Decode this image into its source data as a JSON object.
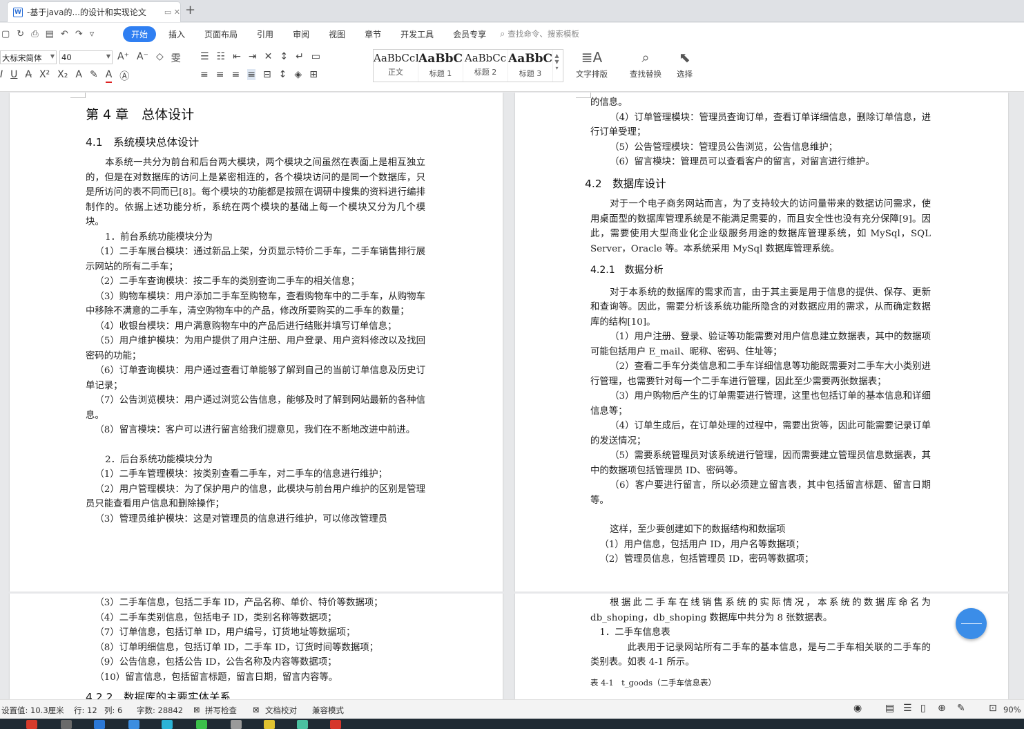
{
  "titlebar": {
    "tab_title": "-基于java的...的设计和实现论文",
    "tab_tail": "▭ ✕",
    "new_tab": "+"
  },
  "menu": {
    "items": [
      "开始",
      "插入",
      "页面布局",
      "引用",
      "审阅",
      "视图",
      "章节",
      "开发工具",
      "会员专享"
    ],
    "search_placeholder": "查找命令、搜索模板"
  },
  "ribbon": {
    "font_name": "大标宋简体",
    "font_size": "40",
    "styles": [
      {
        "preview": "AaBbCcI",
        "label": "正文"
      },
      {
        "preview": "AaBbC",
        "label": "标题 1"
      },
      {
        "preview": "AaBbCc",
        "label": "标题 2"
      },
      {
        "preview": "AaBbC",
        "label": "标题 3"
      }
    ],
    "wordart_label": "文字排版",
    "find_label": "查找替换",
    "select_label": "选择"
  },
  "doc": {
    "left": {
      "chapter": "第 4 章　总体设计",
      "sec_4_1": "4.1　系统模块总体设计",
      "paras": [
        "本系统一共分为前台和后台两大模块，两个模块之间虽然在表面上是相互独立的，但是在对数据库的访问上是紧密相连的，各个模块访问的是同一个数据库，只是所访问的表不同而已[8]。每个模块的功能都是按照在调研中搜集的资料进行编排制作的。依据上述功能分析，系统在两个模块的基础上每一个模块又分为几个模块。",
        "1．前台系统功能模块分为",
        "（1）二手车展台模块：通过新品上架，分页显示特价二手车，二手车销售排行展示网站的所有二手车；",
        "（2）二手车查询模块：按二手车的类别查询二手车的相关信息；",
        "（3）购物车模块：用户添加二手车至购物车，查看购物车中的二手车，从购物车中移除不满意的二手车，清空购物车中的产品，修改所要购买的二手车的数量；",
        "（4）收银台模块：用户满意购物车中的产品后进行结账并填写订单信息；",
        "（5）用户维护模块：为用户提供了用户注册、用户登录、用户资料修改以及找回密码的功能；",
        "（6）订单查询模块：用户通过查看订单能够了解到自己的当前订单信息及历史订单记录；",
        "（7）公告浏览模块：用户通过浏览公告信息，能够及时了解到网站最新的各种信息。",
        "（8）留言模块：客户可以进行留言给我们提意见，我们在不断地改进中前进。",
        "2．后台系统功能模块分为",
        "（1）二手车管理模块：按类别查看二手车，对二手车的信息进行维护；",
        "（2）用户管理模块：为了保护用户的信息，此模块与前台用户维护的区别是管理员只能查看用户信息和删除操作；",
        "（3）管理员维护模块：这是对管理员的信息进行维护，可以修改管理员"
      ],
      "page2": [
        "（3）二手车信息，包括二手车 ID，产品名称、单价、特价等数据项；",
        "（4）二手车类别信息，包括电子 ID，类别名称等数据项；",
        "（7）订单信息，包括订单 ID，用户编号，订货地址等数据项；",
        "（8）订单明细信息，包括订单 ID，二手车 ID，订货时间等数据项；",
        "（9）公告信息，包括公告 ID，公告名称及内容等数据项；",
        "（10）留言信息，包括留言标题，留言日期，留言内容等。"
      ],
      "page2_cut": "4.2.2　数据库的主要实体关系"
    },
    "right": {
      "top": [
        "的信息。",
        "（4）订单管理模块：管理员查询订单，查看订单详细信息，删除订单信息，进行订单受理；",
        "（5）公告管理模块：管理员公告浏览，公告信息维护；",
        "（6）留言模块：管理员可以查看客户的留言，对留言进行维护。"
      ],
      "sec_4_2": "4.2　数据库设计",
      "db_para": "对于一个电子商务网站而言，为了支持较大的访问量带来的数据访问需求，使用桌面型的数据库管理系统是不能满足需要的，而且安全性也没有充分保障[9]。因此，需要使用大型商业化企业级服务用途的数据库管理系统，如 MySql，SQL Server，Oracle 等。本系统采用 MySql 数据库管理系统。",
      "sec_4_2_1": "4.2.1　数据分析",
      "paras": [
        "对于本系统的数据库的需求而言，由于其主要是用于信息的提供、保存、更新和查询等。因此，需要分析该系统功能所隐含的对数据应用的需求，从而确定数据库的结构[10]。",
        "（1）用户注册、登录、验证等功能需要对用户信息建立数据表，其中的数据项可能包括用户 E_mail、昵称、密码、住址等；",
        "（2）查看二手车分类信息和二手车详细信息等功能既需要对二手车大小类别进行管理，也需要针对每一个二手车进行管理，因此至少需要两张数据表；",
        "（3）用户购物后产生的订单需要进行管理，这里也包括订单的基本信息和详细信息等；",
        "（4）订单生成后，在订单处理的过程中，需要出货等，因此可能需要记录订单的发送情况；",
        "（5）需要系统管理员对该系统进行管理，因而需要建立管理员信息数据表，其中的数据项包括管理员 ID、密码等。",
        "（6）客户要进行留言，所以必须建立留言表，其中包括留言标题、留言日期等。",
        "这样，至少要创建如下的数据结构和数据项",
        "（1）用户信息，包括用户 ID，用户名等数据项；",
        "（2）管理员信息，包括管理员 ID，密码等数据项；"
      ],
      "page2": [
        "根据此二手车在线销售系统的实际情况，本系统的数据库命名为 db_shoping，db_shoping 数据库中共分为 8 张数据表。",
        "1．二手车信息表",
        "此表用于记录网站所有二手车的基本信息，是与二手车相关联的二手车的类别表。如表 4-1 所示。",
        "表 4-1　t_goods（二手车信息表）"
      ]
    }
  },
  "status": {
    "setting": "设置值: 10.3厘米",
    "row": "行: 12",
    "col": "列: 6",
    "words": "字数: 28842",
    "spell": "拼写检查",
    "proof": "文档校对",
    "compat": "兼容模式",
    "zoom": "90%"
  }
}
